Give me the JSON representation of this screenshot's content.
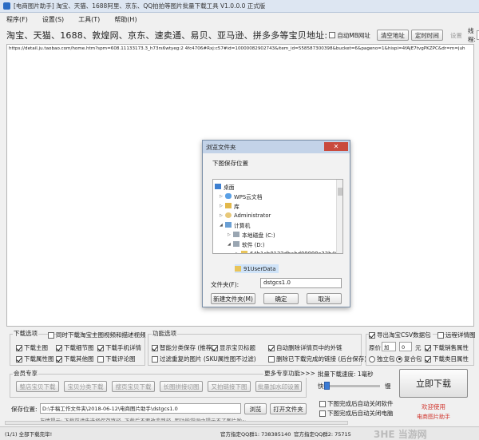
{
  "window": {
    "title": "[电商图片助手]  淘宝、天猫、1688阿里、京东、QQ拍拍等图片批量下载工具 V1.0.0.0 正式版"
  },
  "menu": [
    "程序(F)",
    "设置(S)",
    "工具(T)",
    "帮助(H)"
  ],
  "url_row": {
    "label": "淘宝、天猫、1688、敦煌网、京东、速卖通、易贝、亚马逊、拼多多等宝贝地址:",
    "auto_match_label": "自动MB网址",
    "btn_clear": "清空地址",
    "btn_schedule": "定时时间",
    "btn_settings": "设置",
    "thread_label": "线程:",
    "thread_value": "1"
  },
  "url_text": "https://detail.ju.taobao.com/home.htm?spm=608.11133173.3_h73rs6wtyeg:2 4fc4706#Rxj:c57#id=10000082902743&item_id=558587300398&bucket=6&pageno=1&hispi=4fAjE7tvgPKZPC&dr=m=juh",
  "dialog": {
    "title": "浏览文件夹",
    "prompt": "下图保存位置",
    "tree": [
      "桌面",
      "WPS云文档",
      "库",
      "Administrator",
      "计算机",
      "本地磁盘 (C:)",
      "软件 (D:)",
      "64b1cb0122dbabd09999c33b40",
      "91UserData"
    ],
    "folder_label": "文件夹(F):",
    "folder_value": "dstgcs1.0",
    "btn_new": "新建文件夹(M)",
    "btn_ok": "确定",
    "btn_cancel": "取消",
    "close_glyph": "✕"
  },
  "download_options": {
    "title": "下载选项",
    "also_video": "同时下载淘宝主图视频和描述视频",
    "main_img": "下载主图",
    "detail_img": "下载细节图",
    "mobile_detail": "下载手机详情",
    "attr_img": "下载属性图",
    "other_img": "下载其他图",
    "comment_img": "下载评论图"
  },
  "function_options": {
    "title": "功能选项",
    "smart_save": "智能分类保存 (推荐)",
    "show_title": "显示宝贝标题",
    "auto_remove": "自动删除详情页中的外链",
    "filter_dup": "过滤重复的图片 (SKU属性图不过滤)",
    "delete_done": "删除已下载完成的链接 (后台保存)"
  },
  "right_options": {
    "export_csv": "导出淘宝CSV数据包",
    "remote_detail": "远程详情图",
    "price_label": "原价",
    "price_op": "加",
    "price_value": "0",
    "price_unit": "元",
    "dl_sales_attr": "下载销售属性",
    "standalone": "独立包",
    "merged": "复合包",
    "dl_class_attr": "下载类目属性"
  },
  "vip": {
    "title": "会员专享",
    "more_link": "更多专享功能>>>",
    "buttons": [
      "整店宝贝下载",
      "宝贝分类下载",
      "搜页宝贝下载",
      "长图拼接切图",
      "又拍链接下图",
      "批量加水印设置"
    ]
  },
  "speed": {
    "label": "批量下载速度: 1毫秒",
    "fast": "快",
    "slow": "慢"
  },
  "save_path": {
    "label": "保存位置:",
    "value": "D:\\手稿工作文件夹\\2018-06-12\\电商图片助手\\dstgcs1.0",
    "btn_browse": "浏览",
    "btn_open": "打开文件夹"
  },
  "tip": "友情提示: 下载前请先选择保存路径, 下载后不要改变路径, 因功能错误中提示不了图片啦~",
  "after_download": {
    "auto_close": "下图完成后自动关闭软件",
    "auto_shutdown": "下图完成后自动关闭电脑"
  },
  "start_btn": "立即下载",
  "welcome": "欢迎使用",
  "brand": "电商图片助手",
  "progress": 0,
  "status": {
    "text": "(1/1) 全部下载完毕!",
    "qq1": "官方指定QQ群1: 738385140",
    "qq2": "官方指定QQ群2: 75715"
  },
  "watermark": "3HE 当游网"
}
